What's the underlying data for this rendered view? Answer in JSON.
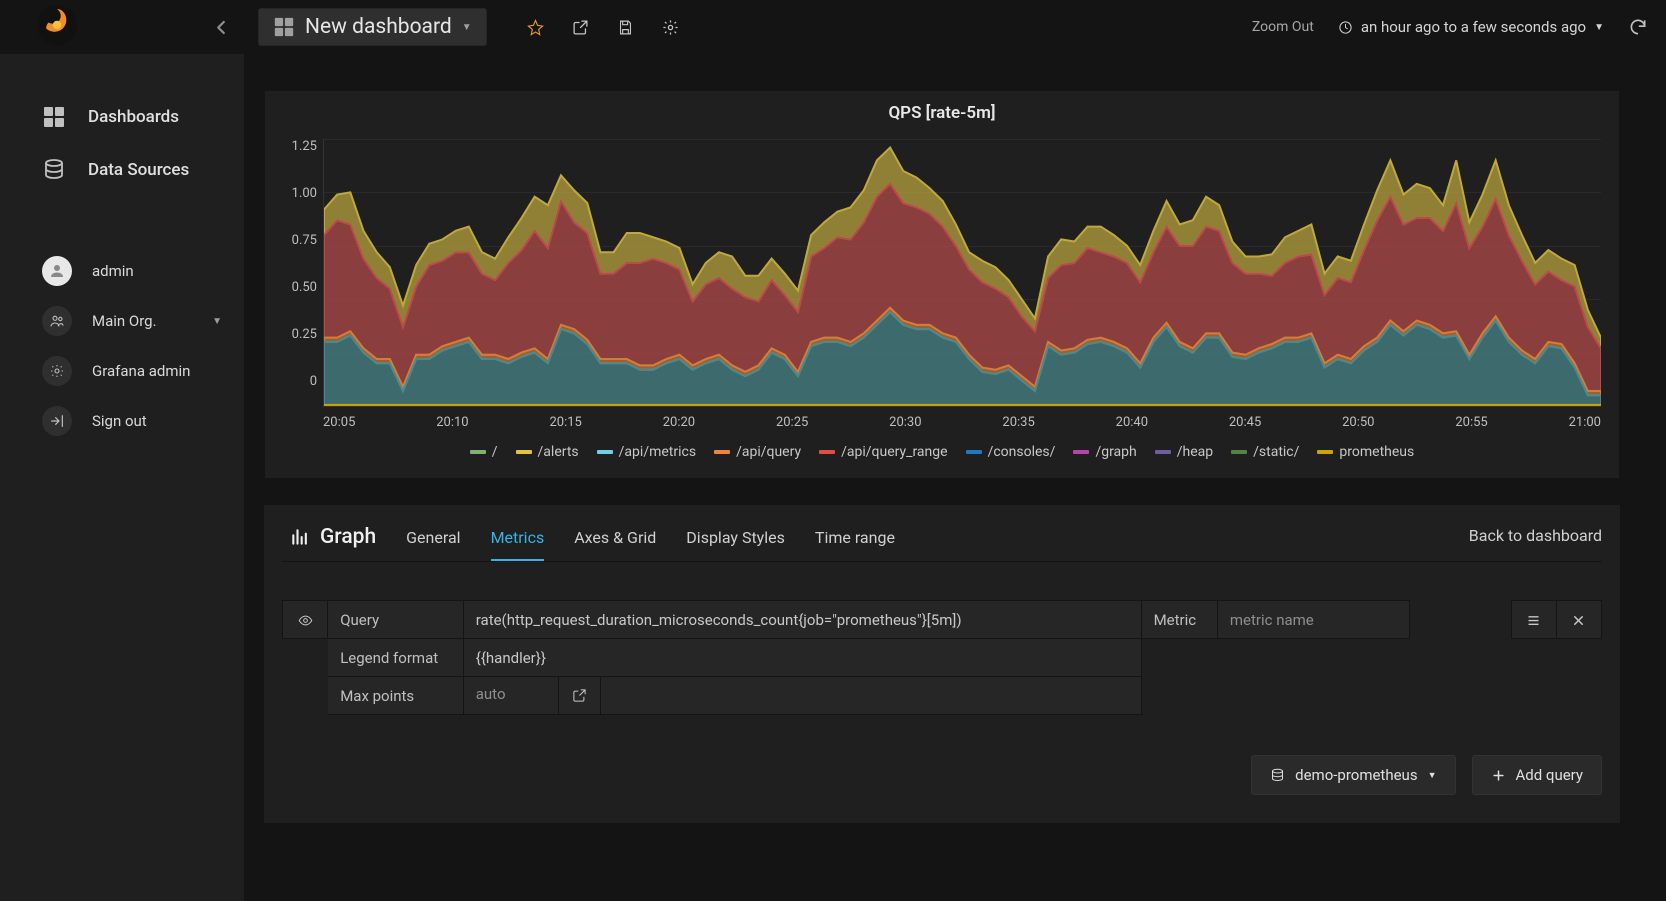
{
  "header": {
    "dashboard_title": "New dashboard",
    "zoom_out": "Zoom Out",
    "time_range_text": "an hour ago to a few seconds ago"
  },
  "sidebar": {
    "nav": [
      {
        "label": "Dashboards",
        "icon": "grid"
      },
      {
        "label": "Data Sources",
        "icon": "database"
      }
    ],
    "user": [
      {
        "label": "admin",
        "icon": "avatar"
      },
      {
        "label": "Main Org.",
        "icon": "users",
        "caret": true
      },
      {
        "label": "Grafana admin",
        "icon": "gear"
      },
      {
        "label": "Sign out",
        "icon": "signout"
      }
    ]
  },
  "panel": {
    "title": "QPS [rate-5m]"
  },
  "chart_data": {
    "type": "area",
    "title": "QPS [rate-5m]",
    "xlabel": "",
    "ylabel": "",
    "ylim": [
      0,
      1.25
    ],
    "y_ticks": [
      "1.25",
      "1.00",
      "0.75",
      "0.50",
      "0.25",
      "0"
    ],
    "x_ticks": [
      "20:05",
      "20:10",
      "20:15",
      "20:20",
      "20:25",
      "20:30",
      "20:35",
      "20:40",
      "20:45",
      "20:50",
      "20:55",
      "21:00"
    ],
    "stacked_series": [
      {
        "name": "/api/metrics",
        "color": "#4a8a8f",
        "values": [
          0.3,
          0.3,
          0.33,
          0.25,
          0.2,
          0.2,
          0.07,
          0.22,
          0.22,
          0.26,
          0.28,
          0.3,
          0.22,
          0.22,
          0.2,
          0.23,
          0.25,
          0.2,
          0.36,
          0.34,
          0.29,
          0.2,
          0.2,
          0.2,
          0.17,
          0.17,
          0.2,
          0.22,
          0.17,
          0.2,
          0.22,
          0.17,
          0.14,
          0.17,
          0.25,
          0.22,
          0.14,
          0.28,
          0.3,
          0.3,
          0.28,
          0.32,
          0.38,
          0.44,
          0.38,
          0.36,
          0.36,
          0.32,
          0.3,
          0.22,
          0.16,
          0.15,
          0.17,
          0.12,
          0.07,
          0.28,
          0.24,
          0.25,
          0.29,
          0.3,
          0.28,
          0.25,
          0.18,
          0.3,
          0.37,
          0.28,
          0.25,
          0.32,
          0.32,
          0.23,
          0.22,
          0.25,
          0.27,
          0.3,
          0.3,
          0.32,
          0.18,
          0.22,
          0.2,
          0.26,
          0.3,
          0.38,
          0.33,
          0.38,
          0.36,
          0.32,
          0.33,
          0.22,
          0.32,
          0.4,
          0.3,
          0.24,
          0.2,
          0.28,
          0.27,
          0.18,
          0.05,
          0.05
        ]
      },
      {
        "name": "/api/query",
        "color": "#d37d39",
        "values": [
          0.02,
          0.02,
          0.02,
          0.02,
          0.02,
          0.02,
          0.02,
          0.02,
          0.02,
          0.02,
          0.02,
          0.02,
          0.02,
          0.02,
          0.02,
          0.02,
          0.02,
          0.02,
          0.02,
          0.02,
          0.02,
          0.02,
          0.02,
          0.02,
          0.02,
          0.02,
          0.02,
          0.02,
          0.02,
          0.02,
          0.02,
          0.02,
          0.02,
          0.02,
          0.02,
          0.02,
          0.02,
          0.02,
          0.02,
          0.02,
          0.02,
          0.02,
          0.02,
          0.02,
          0.02,
          0.02,
          0.02,
          0.02,
          0.02,
          0.02,
          0.02,
          0.02,
          0.02,
          0.02,
          0.02,
          0.02,
          0.02,
          0.02,
          0.02,
          0.02,
          0.02,
          0.02,
          0.02,
          0.02,
          0.02,
          0.02,
          0.02,
          0.02,
          0.02,
          0.02,
          0.02,
          0.02,
          0.02,
          0.02,
          0.02,
          0.02,
          0.02,
          0.02,
          0.02,
          0.02,
          0.02,
          0.02,
          0.02,
          0.02,
          0.02,
          0.02,
          0.02,
          0.02,
          0.02,
          0.02,
          0.02,
          0.02,
          0.02,
          0.02,
          0.02,
          0.02,
          0.02,
          0.02
        ]
      },
      {
        "name": "/api/query_range",
        "color": "#b94b4b",
        "values": [
          0.48,
          0.55,
          0.5,
          0.42,
          0.38,
          0.33,
          0.28,
          0.32,
          0.42,
          0.4,
          0.42,
          0.4,
          0.38,
          0.35,
          0.45,
          0.48,
          0.55,
          0.52,
          0.58,
          0.5,
          0.5,
          0.4,
          0.4,
          0.45,
          0.48,
          0.5,
          0.45,
          0.4,
          0.3,
          0.35,
          0.36,
          0.36,
          0.35,
          0.3,
          0.32,
          0.28,
          0.28,
          0.4,
          0.42,
          0.47,
          0.48,
          0.52,
          0.58,
          0.58,
          0.55,
          0.55,
          0.52,
          0.5,
          0.43,
          0.4,
          0.4,
          0.38,
          0.32,
          0.28,
          0.26,
          0.3,
          0.4,
          0.4,
          0.43,
          0.4,
          0.4,
          0.4,
          0.38,
          0.4,
          0.45,
          0.45,
          0.48,
          0.5,
          0.48,
          0.42,
          0.38,
          0.35,
          0.32,
          0.35,
          0.38,
          0.37,
          0.32,
          0.36,
          0.36,
          0.45,
          0.55,
          0.58,
          0.5,
          0.48,
          0.5,
          0.48,
          0.6,
          0.5,
          0.5,
          0.55,
          0.48,
          0.42,
          0.35,
          0.33,
          0.3,
          0.36,
          0.3,
          0.2
        ]
      },
      {
        "name": "prometheus",
        "color": "#bfa93e",
        "values": [
          0.12,
          0.12,
          0.15,
          0.13,
          0.12,
          0.1,
          0.1,
          0.1,
          0.1,
          0.1,
          0.1,
          0.12,
          0.1,
          0.1,
          0.12,
          0.15,
          0.16,
          0.2,
          0.12,
          0.15,
          0.14,
          0.1,
          0.1,
          0.14,
          0.14,
          0.1,
          0.1,
          0.1,
          0.08,
          0.1,
          0.12,
          0.15,
          0.1,
          0.12,
          0.1,
          0.1,
          0.1,
          0.1,
          0.12,
          0.12,
          0.15,
          0.15,
          0.17,
          0.17,
          0.15,
          0.14,
          0.12,
          0.12,
          0.1,
          0.08,
          0.1,
          0.1,
          0.08,
          0.08,
          0.06,
          0.1,
          0.12,
          0.1,
          0.1,
          0.12,
          0.1,
          0.08,
          0.08,
          0.1,
          0.12,
          0.1,
          0.12,
          0.14,
          0.12,
          0.1,
          0.08,
          0.08,
          0.1,
          0.12,
          0.12,
          0.14,
          0.1,
          0.1,
          0.1,
          0.12,
          0.14,
          0.17,
          0.14,
          0.16,
          0.14,
          0.12,
          0.2,
          0.12,
          0.15,
          0.18,
          0.14,
          0.12,
          0.1,
          0.1,
          0.1,
          0.1,
          0.08,
          0.05
        ]
      }
    ],
    "series": [
      {
        "name": "/",
        "color": "#7eb26d"
      },
      {
        "name": "/alerts",
        "color": "#e0c341"
      },
      {
        "name": "/api/metrics",
        "color": "#6ed0e0"
      },
      {
        "name": "/api/query",
        "color": "#ef843c"
      },
      {
        "name": "/api/query_range",
        "color": "#e24d42"
      },
      {
        "name": "/consoles/",
        "color": "#1f78c1"
      },
      {
        "name": "/graph",
        "color": "#ba43a9"
      },
      {
        "name": "/heap",
        "color": "#705da0"
      },
      {
        "name": "/static/",
        "color": "#508642"
      },
      {
        "name": "prometheus",
        "color": "#cca300"
      }
    ]
  },
  "editor": {
    "type_label": "Graph",
    "tabs": [
      "General",
      "Metrics",
      "Axes & Grid",
      "Display Styles",
      "Time range"
    ],
    "active_tab": "Metrics",
    "back_label": "Back to dashboard",
    "query_row": {
      "query_label": "Query",
      "query_value": "rate(http_request_duration_microseconds_count{job=\"prometheus\"}[5m])",
      "metric_label": "Metric",
      "metric_placeholder": "metric name"
    },
    "legend_row": {
      "label": "Legend format",
      "value": "{{handler}}"
    },
    "maxpoints_row": {
      "label": "Max points",
      "placeholder": "auto"
    },
    "datasource_button": "demo-prometheus",
    "add_query_button": "Add query"
  }
}
